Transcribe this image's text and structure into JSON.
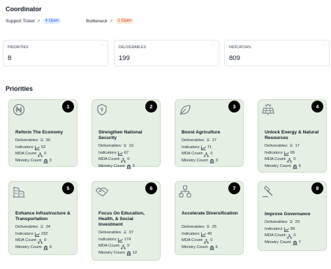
{
  "header": {
    "title": "Coordinator"
  },
  "links": [
    {
      "label": "Support Ticket",
      "badge": "4 Open",
      "tone": "blue"
    },
    {
      "label": "Bottleneck",
      "badge": "1 Open",
      "tone": "orange"
    }
  ],
  "stats": [
    {
      "label": "PRIORITIES",
      "value": "8"
    },
    {
      "label": "DELIVERABLES",
      "value": "199"
    },
    {
      "label": "INDICATORS",
      "value": "809"
    }
  ],
  "section_title": "Priorities",
  "metric_labels": {
    "deliverables": "Deliverables:",
    "indicators": "Indicators:",
    "mda": "MDA Count:",
    "ministry": "Ministry Count:"
  },
  "priorities": [
    {
      "num": "1",
      "title": "Reform The Economy",
      "icon": "naira-coin-icon",
      "deliverables": "30",
      "indicators": "52",
      "mda": "0",
      "ministry": "3"
    },
    {
      "num": "2",
      "title": "Strengthen National Security",
      "icon": "shield-icon",
      "deliverables": "10",
      "indicators": "67",
      "mda": "0",
      "ministry": "3"
    },
    {
      "num": "3",
      "title": "Boost Agriculture",
      "icon": "leaf-icon",
      "deliverables": "17",
      "indicators": "71",
      "mda": "0",
      "ministry": "3"
    },
    {
      "num": "4",
      "title": "Unlock Energy & Natural Resources",
      "icon": "solar-panel-icon",
      "deliverables": "17",
      "indicators": "65",
      "mda": "0",
      "ministry": "5"
    },
    {
      "num": "5",
      "title": "Enhance Infrastructure & Transportation",
      "icon": "building-icon",
      "deliverables": "34",
      "indicators": "232",
      "mda": "0",
      "ministry": "9"
    },
    {
      "num": "6",
      "title": "Focus On Education, Health, & Social Investment",
      "icon": "handshake-icon",
      "deliverables": "37",
      "indicators": "174",
      "mda": "0",
      "ministry": "12"
    },
    {
      "num": "7",
      "title": "Accelerate Diversification",
      "icon": "network-icon",
      "deliverables": "25",
      "indicators": "49",
      "mda": "0",
      "ministry": "6"
    },
    {
      "num": "8",
      "title": "Improve Governance",
      "icon": "gavel-icon",
      "deliverables": "29",
      "indicators": "99",
      "mda": "0",
      "ministry": "7"
    }
  ]
}
